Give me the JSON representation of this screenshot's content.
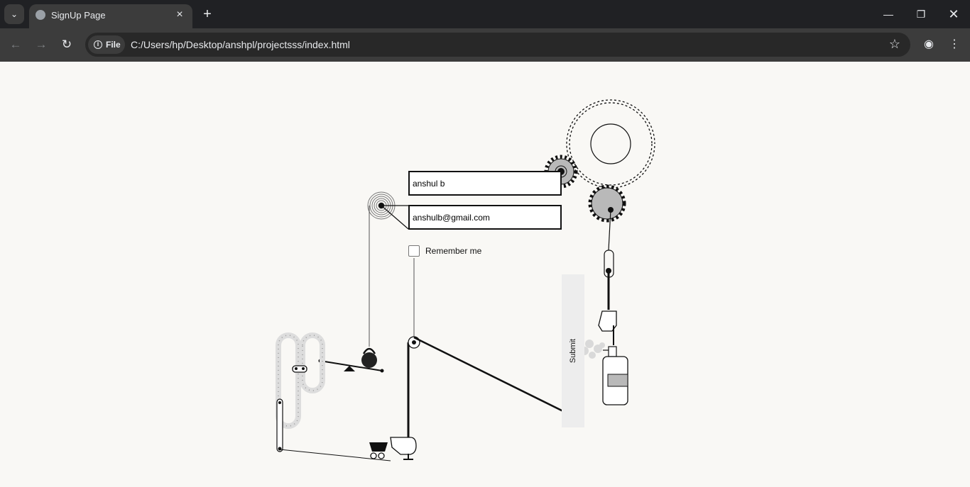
{
  "browser": {
    "tab_title": "SignUp Page",
    "address_chip": "File",
    "url": "C:/Users/hp/Desktop/anshpl/projectsss/index.html"
  },
  "form": {
    "name_value": "anshul b",
    "email_value": "anshulb@gmail.com",
    "remember_label": "Remember me",
    "remember_checked": false,
    "submit_label": "Submit"
  }
}
